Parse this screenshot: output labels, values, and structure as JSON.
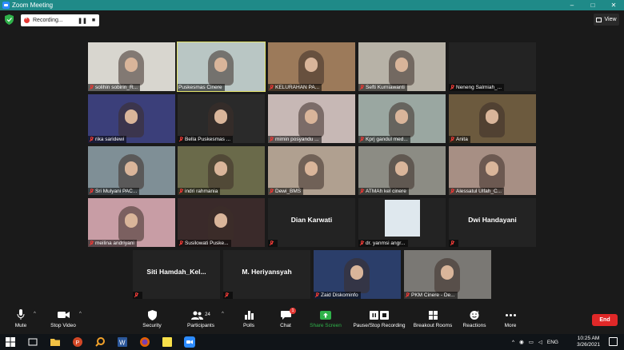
{
  "window": {
    "title": "Zoom Meeting",
    "minimize": "–",
    "maximize": "□",
    "close": "✕"
  },
  "recording": {
    "label": "Recording...",
    "pause": "❚❚",
    "stop": "■"
  },
  "view_button": {
    "label": "View"
  },
  "participants": [
    {
      "name": "solihin sobirin_R...",
      "bg": "#d8d6cf"
    },
    {
      "name": "Puskesmas Cinere",
      "bg": "#b9c6c4",
      "active": true
    },
    {
      "name": "KELURAHAN PA...",
      "bg": "#9c7a5a"
    },
    {
      "name": "Sefti Kurniawanti",
      "bg": "#b7b2a7"
    },
    {
      "name": "Neneng Salmiah_...",
      "bg": "#232323"
    },
    {
      "name": "rika saridewi",
      "bg": "#3b3f7a"
    },
    {
      "name": "Bella Puskesmas ...",
      "bg": "#2a2a2a"
    },
    {
      "name": "mimin posyandu ...",
      "bg": "#c7b8b5"
    },
    {
      "name": "Kprj gandul med...",
      "bg": "#9aa7a1"
    },
    {
      "name": "Anita",
      "bg": "#6c5a3e"
    },
    {
      "name": "Sri Mulyani PAC...",
      "bg": "#7f8f96"
    },
    {
      "name": "indri rahmania",
      "bg": "#6a6a4a"
    },
    {
      "name": "Dewi_BMS",
      "bg": "#b0a090"
    },
    {
      "name": "ATMAh kel cinere",
      "bg": "#8c8c84"
    },
    {
      "name": "Alessatul Ulfah_C...",
      "bg": "#a78f84"
    },
    {
      "name": "meilina andriyani",
      "bg": "#c89da5"
    },
    {
      "name": "Susilowati Puske...",
      "bg": "#3a2a2a"
    },
    {
      "name": "Dian Karwati",
      "bg": "#232323",
      "nameOnly": true
    },
    {
      "name": "dr. yanmsi angr...",
      "bg": "#232323"
    },
    {
      "name": "Dwi Handayani",
      "bg": "#232323",
      "nameOnly": true
    },
    {
      "name": "Siti  Hamdah_Kel...",
      "bg": "#232323",
      "nameOnly": true
    },
    {
      "name": "M. Heriyansyah",
      "bg": "#232323",
      "nameOnly": true
    },
    {
      "name": "Zaid Diskominfo",
      "bg": "#2b3e6a"
    },
    {
      "name": "PKM Cinere - De...",
      "bg": "#7a7874"
    }
  ],
  "toolbar": {
    "mute": "Mute",
    "stop_video": "Stop Video",
    "security": "Security",
    "participants": "Participants",
    "participants_count": "24",
    "polls": "Polls",
    "chat": "Chat",
    "chat_badge": "1",
    "share_screen": "Share Screen",
    "record": "Pause/Stop Recording",
    "breakout": "Breakout Rooms",
    "reactions": "Reactions",
    "more": "More",
    "end": "End"
  },
  "taskbar": {
    "lang": "ENG",
    "time": "10:25 AM",
    "date": "3/26/2021"
  },
  "colors": {
    "accent_green": "#1f8a88",
    "end_red": "#e02828",
    "share_green": "#2fb24a",
    "active_outline": "#e3e36b"
  }
}
